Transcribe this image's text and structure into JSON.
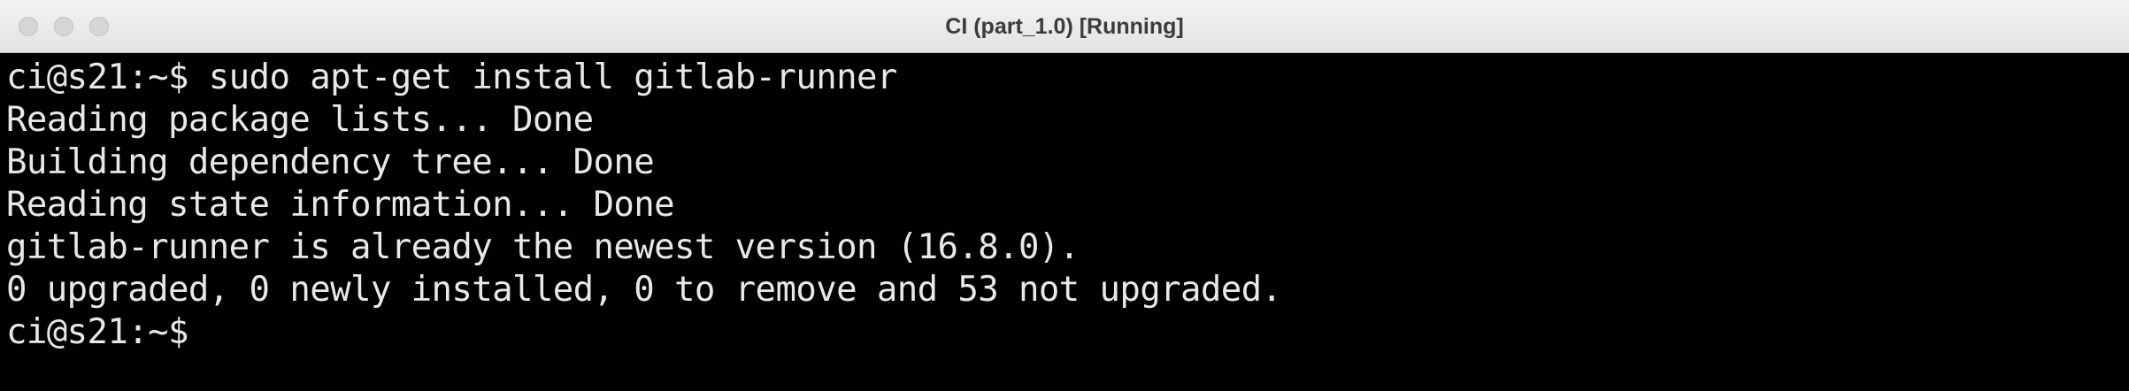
{
  "window": {
    "title": "CI (part_1.0) [Running]"
  },
  "terminal": {
    "lines": [
      "ci@s21:~$ sudo apt-get install gitlab-runner",
      "Reading package lists... Done",
      "Building dependency tree... Done",
      "Reading state information... Done",
      "gitlab-runner is already the newest version (16.8.0).",
      "0 upgraded, 0 newly installed, 0 to remove and 53 not upgraded.",
      "ci@s21:~$"
    ]
  },
  "colors": {
    "terminal_bg": "#000000",
    "terminal_fg": "#e8e8e8",
    "titlebar_bg": "#ececec"
  }
}
